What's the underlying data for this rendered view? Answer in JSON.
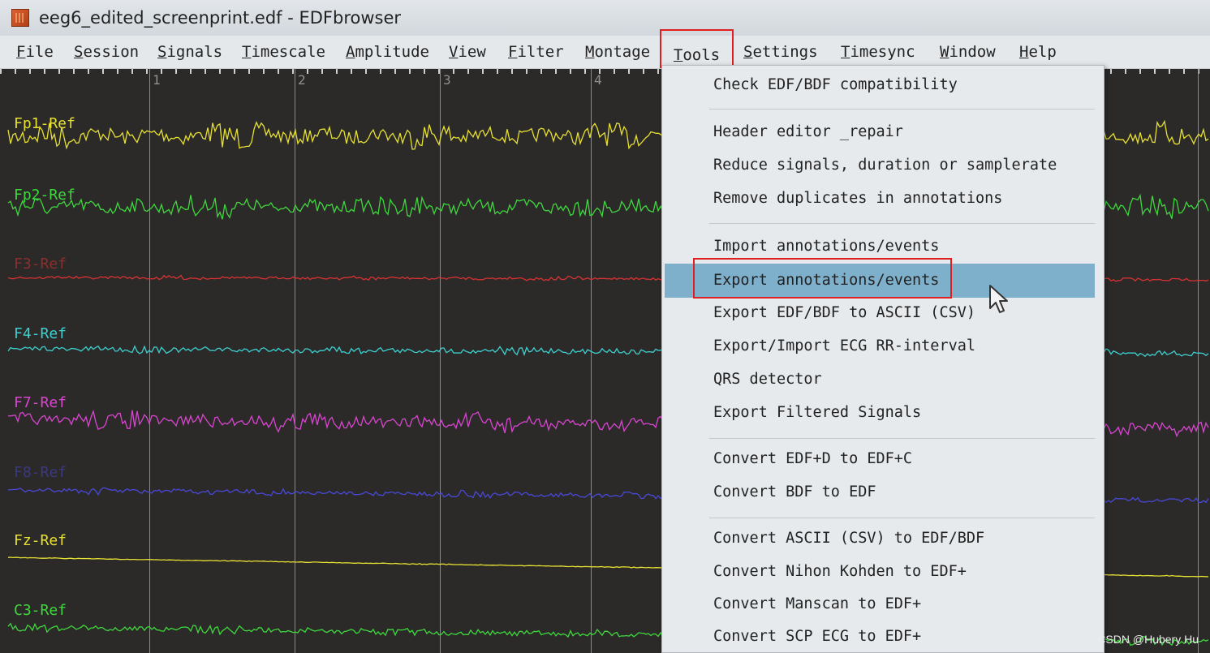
{
  "window": {
    "title": "eeg6_edited_screenprint.edf - EDFbrowser"
  },
  "menubar": {
    "items": [
      "File",
      "Session",
      "Signals",
      "Timescale",
      "Amplitude",
      "View",
      "Filter",
      "Montage",
      "Tools",
      "Settings",
      "Timesync",
      "Window",
      "Help"
    ],
    "active": "Tools"
  },
  "timeline": {
    "second_labels": [
      "1",
      "2",
      "3",
      "4"
    ]
  },
  "channels": [
    {
      "label": "Fp1-Ref",
      "color": "#e6e032"
    },
    {
      "label": "Fp2-Ref",
      "color": "#3ed83e"
    },
    {
      "label": "F3-Ref",
      "color": "#d83232"
    },
    {
      "label": "F4-Ref",
      "color": "#3cd0d0"
    },
    {
      "label": "F7-Ref",
      "color": "#d846d0"
    },
    {
      "label": "F8-Ref",
      "color": "#4848d8"
    },
    {
      "label": "Fz-Ref",
      "color": "#e6e032"
    },
    {
      "label": "C3-Ref",
      "color": "#3ed83e"
    }
  ],
  "tools_menu": {
    "items": [
      "Check EDF/BDF compatibility",
      "Header editor _repair",
      "Reduce signals, duration or samplerate",
      "Remove duplicates in annotations",
      "Import annotations/events",
      "Export annotations/events",
      "Export EDF/BDF to ASCII (CSV)",
      "Export/Import ECG RR-interval",
      "QRS detector",
      "Export Filtered Signals",
      "Convert EDF+D to EDF+C",
      "Convert BDF to EDF",
      "Convert ASCII (CSV) to EDF/BDF",
      "Convert Nihon Kohden to EDF+",
      "Convert Manscan to EDF+",
      "Convert SCP ECG to EDF+"
    ],
    "highlighted": "Export annotations/events"
  },
  "watermark": "CSDN @Hubery Hu"
}
